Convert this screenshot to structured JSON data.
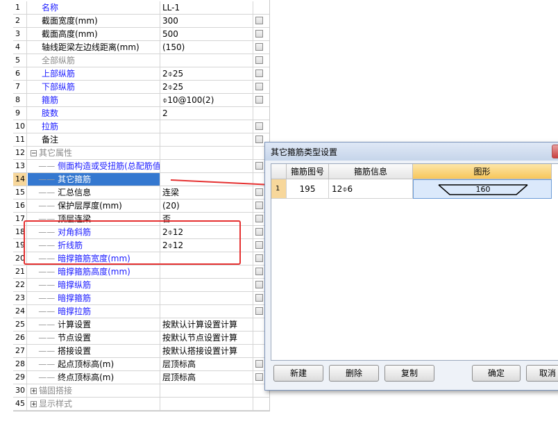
{
  "grid_rows": [
    {
      "num": "1",
      "name": "名称",
      "value": "LL-1",
      "style": "blue",
      "indent": 0,
      "check": false
    },
    {
      "num": "2",
      "name": "截面宽度(mm)",
      "value": "300",
      "style": "",
      "indent": 0,
      "check": true
    },
    {
      "num": "3",
      "name": "截面高度(mm)",
      "value": "500",
      "style": "",
      "indent": 0,
      "check": true
    },
    {
      "num": "4",
      "name": "轴线距梁左边线距离(mm)",
      "value": "(150)",
      "style": "",
      "indent": 0,
      "check": true
    },
    {
      "num": "5",
      "name": "全部纵筋",
      "value": "",
      "style": "gray",
      "indent": 0,
      "check": true
    },
    {
      "num": "6",
      "name": "上部纵筋",
      "value": "2⌽25",
      "style": "blue",
      "indent": 0,
      "check": true
    },
    {
      "num": "7",
      "name": "下部纵筋",
      "value": "2⌽25",
      "style": "blue",
      "indent": 0,
      "check": true
    },
    {
      "num": "8",
      "name": "箍筋",
      "value": "⌽10@100(2)",
      "style": "blue",
      "indent": 0,
      "check": true
    },
    {
      "num": "9",
      "name": "肢数",
      "value": "2",
      "style": "blue",
      "indent": 0,
      "check": false
    },
    {
      "num": "10",
      "name": "拉筋",
      "value": "",
      "style": "blue",
      "indent": 0,
      "check": true
    },
    {
      "num": "11",
      "name": "备注",
      "value": "",
      "style": "",
      "indent": 0,
      "check": true
    },
    {
      "num": "12",
      "name": "其它属性",
      "value": "",
      "style": "gray",
      "indent": 0,
      "check": false,
      "expander": "−"
    },
    {
      "num": "13",
      "name": "侧面构造或受扭筋(总配筋值)",
      "value": "",
      "style": "blue",
      "indent": 1,
      "check": true
    },
    {
      "num": "14",
      "name": "其它箍筋",
      "value": "",
      "style": "",
      "indent": 1,
      "check": false,
      "selected": true
    },
    {
      "num": "15",
      "name": "汇总信息",
      "value": "连梁",
      "style": "",
      "indent": 1,
      "check": true
    },
    {
      "num": "16",
      "name": "保护层厚度(mm)",
      "value": "(20)",
      "style": "",
      "indent": 1,
      "check": true
    },
    {
      "num": "17",
      "name": "顶层连梁",
      "value": "否",
      "style": "",
      "indent": 1,
      "check": true
    },
    {
      "num": "18",
      "name": "对角斜筋",
      "value": "2⌽12",
      "style": "blue",
      "indent": 1,
      "check": true
    },
    {
      "num": "19",
      "name": "折线筋",
      "value": "2⌽12",
      "style": "blue",
      "indent": 1,
      "check": true
    },
    {
      "num": "20",
      "name": "暗撑箍筋宽度(mm)",
      "value": "",
      "style": "blue",
      "indent": 1,
      "check": true
    },
    {
      "num": "21",
      "name": "暗撑箍筋高度(mm)",
      "value": "",
      "style": "blue",
      "indent": 1,
      "check": true
    },
    {
      "num": "22",
      "name": "暗撑纵筋",
      "value": "",
      "style": "blue",
      "indent": 1,
      "check": true
    },
    {
      "num": "23",
      "name": "暗撑箍筋",
      "value": "",
      "style": "blue",
      "indent": 1,
      "check": true
    },
    {
      "num": "24",
      "name": "暗撑拉筋",
      "value": "",
      "style": "blue",
      "indent": 1,
      "check": true
    },
    {
      "num": "25",
      "name": "计算设置",
      "value": "按默认计算设置计算",
      "style": "",
      "indent": 1,
      "check": false
    },
    {
      "num": "26",
      "name": "节点设置",
      "value": "按默认节点设置计算",
      "style": "",
      "indent": 1,
      "check": false
    },
    {
      "num": "27",
      "name": "搭接设置",
      "value": "按默认搭接设置计算",
      "style": "",
      "indent": 1,
      "check": false
    },
    {
      "num": "28",
      "name": "起点顶标高(m)",
      "value": "层顶标高",
      "style": "",
      "indent": 1,
      "check": true
    },
    {
      "num": "29",
      "name": "终点顶标高(m)",
      "value": "层顶标高",
      "style": "",
      "indent": 1,
      "check": true
    },
    {
      "num": "30",
      "name": "锚固搭接",
      "value": "",
      "style": "gray",
      "indent": 0,
      "check": false,
      "expander": "+"
    },
    {
      "num": "45",
      "name": "显示样式",
      "value": "",
      "style": "gray",
      "indent": 0,
      "check": false,
      "expander": "+"
    }
  ],
  "dialog": {
    "title": "其它箍筋类型设置",
    "columns": [
      "箍筋图号",
      "箍筋信息",
      "图形"
    ],
    "row": {
      "num": "1",
      "shape_no": "195",
      "info": "12⌽6",
      "dimension": "160"
    },
    "buttons": {
      "new": "新建",
      "delete": "删除",
      "copy": "复制",
      "ok": "确定",
      "cancel": "取消"
    }
  },
  "colors": {
    "annotation": "#e53030",
    "selection": "#3478d0",
    "label_blue": "#1a1aff"
  }
}
